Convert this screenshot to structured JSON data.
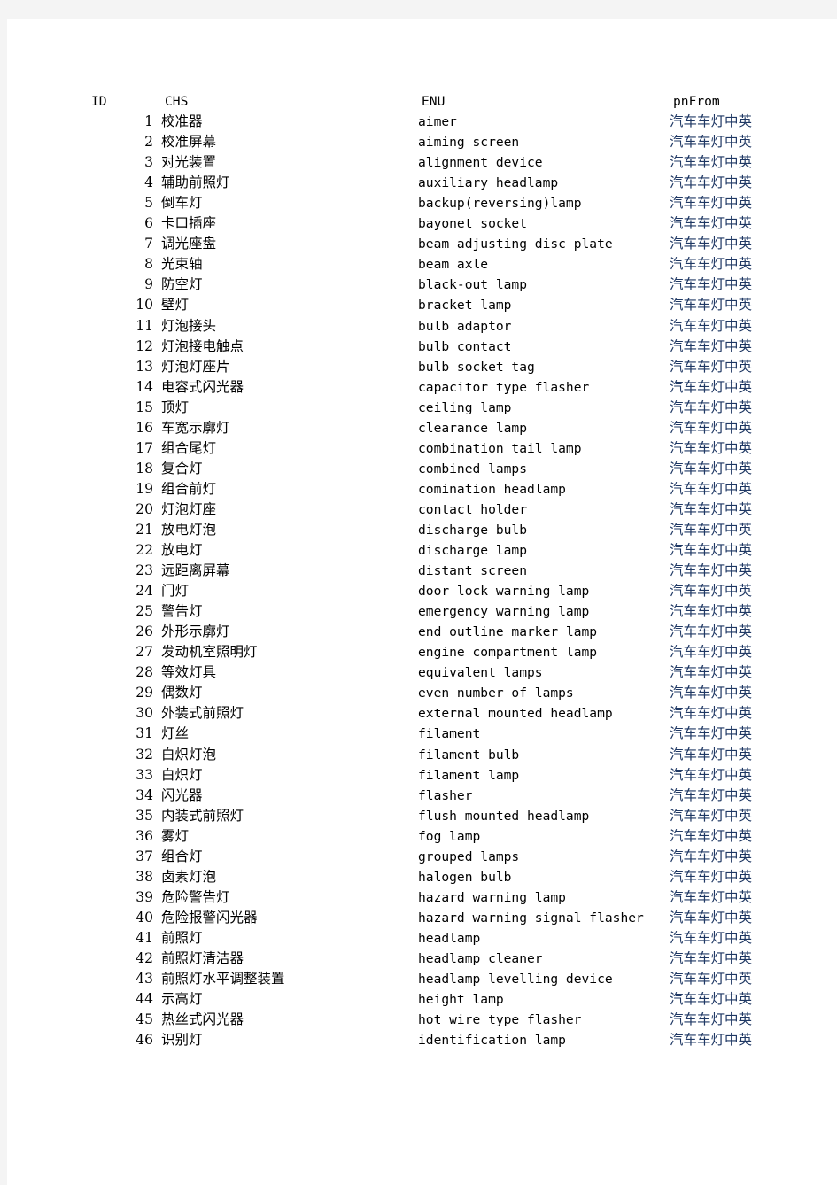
{
  "page": {
    "background_color": "#f4f4f4",
    "sheet_color": "#ffffff",
    "pnfrom_text_color": "#1f3864"
  },
  "table": {
    "columns": [
      {
        "key": "id",
        "header": "ID"
      },
      {
        "key": "chs",
        "header": "CHS"
      },
      {
        "key": "enu",
        "header": "ENU"
      },
      {
        "key": "pnfrom",
        "header": "pnFrom"
      }
    ],
    "rows": [
      {
        "id": "1",
        "chs": "校准器",
        "enu": "aimer",
        "pnfrom": "汽车车灯中英"
      },
      {
        "id": "2",
        "chs": "校准屏幕",
        "enu": "aiming screen",
        "pnfrom": "汽车车灯中英"
      },
      {
        "id": "3",
        "chs": "对光装置",
        "enu": "alignment device",
        "pnfrom": "汽车车灯中英"
      },
      {
        "id": "4",
        "chs": "辅助前照灯",
        "enu": "auxiliary headlamp",
        "pnfrom": "汽车车灯中英"
      },
      {
        "id": "5",
        "chs": "倒车灯",
        "enu": "backup(reversing)lamp",
        "pnfrom": "汽车车灯中英"
      },
      {
        "id": "6",
        "chs": "卡口插座",
        "enu": "bayonet socket",
        "pnfrom": "汽车车灯中英"
      },
      {
        "id": "7",
        "chs": "调光座盘",
        "enu": "beam adjusting disc plate",
        "pnfrom": "汽车车灯中英"
      },
      {
        "id": "8",
        "chs": "光束轴",
        "enu": "beam axle",
        "pnfrom": "汽车车灯中英"
      },
      {
        "id": "9",
        "chs": "防空灯",
        "enu": "black-out lamp",
        "pnfrom": "汽车车灯中英"
      },
      {
        "id": "10",
        "chs": "壁灯",
        "enu": "bracket lamp",
        "pnfrom": "汽车车灯中英"
      },
      {
        "id": "11",
        "chs": "灯泡接头",
        "enu": "bulb adaptor",
        "pnfrom": "汽车车灯中英"
      },
      {
        "id": "12",
        "chs": "灯泡接电触点",
        "enu": "bulb contact",
        "pnfrom": "汽车车灯中英"
      },
      {
        "id": "13",
        "chs": "灯泡灯座片",
        "enu": "bulb socket tag",
        "pnfrom": "汽车车灯中英"
      },
      {
        "id": "14",
        "chs": "电容式闪光器",
        "enu": "capacitor type flasher",
        "pnfrom": "汽车车灯中英"
      },
      {
        "id": "15",
        "chs": "顶灯",
        "enu": "ceiling lamp",
        "pnfrom": "汽车车灯中英"
      },
      {
        "id": "16",
        "chs": "车宽示廓灯",
        "enu": "clearance lamp",
        "pnfrom": "汽车车灯中英"
      },
      {
        "id": "17",
        "chs": "组合尾灯",
        "enu": "combination tail lamp",
        "pnfrom": "汽车车灯中英"
      },
      {
        "id": "18",
        "chs": "复合灯",
        "enu": "combined lamps",
        "pnfrom": "汽车车灯中英"
      },
      {
        "id": "19",
        "chs": "组合前灯",
        "enu": "comination headlamp",
        "pnfrom": "汽车车灯中英"
      },
      {
        "id": "20",
        "chs": "灯泡灯座",
        "enu": "contact holder",
        "pnfrom": "汽车车灯中英"
      },
      {
        "id": "21",
        "chs": "放电灯泡",
        "enu": "discharge bulb",
        "pnfrom": "汽车车灯中英"
      },
      {
        "id": "22",
        "chs": "放电灯",
        "enu": "discharge lamp",
        "pnfrom": "汽车车灯中英"
      },
      {
        "id": "23",
        "chs": "远距离屏幕",
        "enu": "distant screen",
        "pnfrom": "汽车车灯中英"
      },
      {
        "id": "24",
        "chs": "门灯",
        "enu": "door lock warning lamp",
        "pnfrom": "汽车车灯中英"
      },
      {
        "id": "25",
        "chs": "警告灯",
        "enu": "emergency warning lamp",
        "pnfrom": "汽车车灯中英"
      },
      {
        "id": "26",
        "chs": "外形示廓灯",
        "enu": "end outline marker lamp",
        "pnfrom": "汽车车灯中英"
      },
      {
        "id": "27",
        "chs": "发动机室照明灯",
        "enu": "engine compartment lamp",
        "pnfrom": "汽车车灯中英"
      },
      {
        "id": "28",
        "chs": "等效灯具",
        "enu": "equivalent lamps",
        "pnfrom": "汽车车灯中英"
      },
      {
        "id": "29",
        "chs": "偶数灯",
        "enu": "even number of lamps",
        "pnfrom": "汽车车灯中英"
      },
      {
        "id": "30",
        "chs": "外装式前照灯",
        "enu": "external mounted headlamp",
        "pnfrom": "汽车车灯中英"
      },
      {
        "id": "31",
        "chs": "灯丝",
        "enu": "filament",
        "pnfrom": "汽车车灯中英"
      },
      {
        "id": "32",
        "chs": "白炽灯泡",
        "enu": "filament bulb",
        "pnfrom": "汽车车灯中英"
      },
      {
        "id": "33",
        "chs": "白炽灯",
        "enu": "filament lamp",
        "pnfrom": "汽车车灯中英"
      },
      {
        "id": "34",
        "chs": "闪光器",
        "enu": "flasher",
        "pnfrom": "汽车车灯中英"
      },
      {
        "id": "35",
        "chs": "内装式前照灯",
        "enu": "flush mounted headlamp",
        "pnfrom": "汽车车灯中英"
      },
      {
        "id": "36",
        "chs": "雾灯",
        "enu": "fog lamp",
        "pnfrom": "汽车车灯中英"
      },
      {
        "id": "37",
        "chs": "组合灯",
        "enu": "grouped lamps",
        "pnfrom": "汽车车灯中英"
      },
      {
        "id": "38",
        "chs": "卤素灯泡",
        "enu": "halogen bulb",
        "pnfrom": "汽车车灯中英"
      },
      {
        "id": "39",
        "chs": "危险警告灯",
        "enu": "hazard warning lamp",
        "pnfrom": "汽车车灯中英"
      },
      {
        "id": "40",
        "chs": "危险报警闪光器",
        "enu": "hazard warning signal flasher",
        "pnfrom": "汽车车灯中英"
      },
      {
        "id": "41",
        "chs": "前照灯",
        "enu": "headlamp",
        "pnfrom": "汽车车灯中英"
      },
      {
        "id": "42",
        "chs": "前照灯清洁器",
        "enu": "headlamp cleaner",
        "pnfrom": "汽车车灯中英"
      },
      {
        "id": "43",
        "chs": "前照灯水平调整装置",
        "enu": "headlamp levelling device",
        "pnfrom": "汽车车灯中英"
      },
      {
        "id": "44",
        "chs": "示高灯",
        "enu": "height lamp",
        "pnfrom": "汽车车灯中英"
      },
      {
        "id": "45",
        "chs": "热丝式闪光器",
        "enu": "hot wire type flasher",
        "pnfrom": "汽车车灯中英"
      },
      {
        "id": "46",
        "chs": "识别灯",
        "enu": "identification lamp",
        "pnfrom": "汽车车灯中英"
      }
    ]
  }
}
